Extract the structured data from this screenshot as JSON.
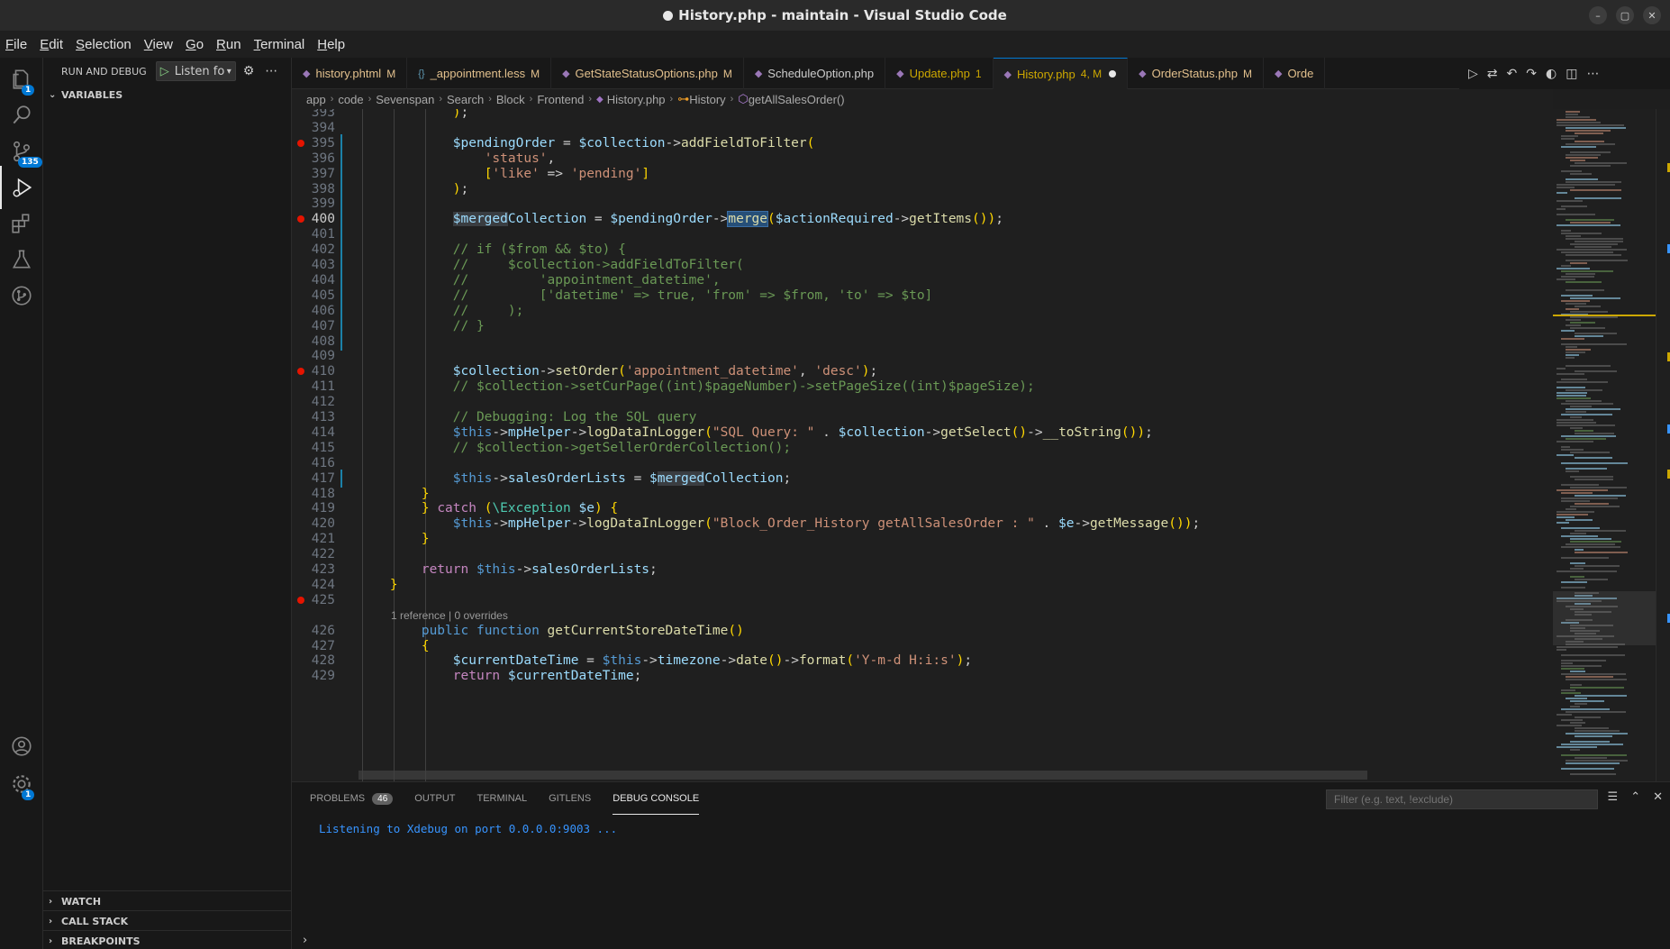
{
  "window": {
    "title": "History.php - maintain - Visual Studio Code",
    "controls": [
      "–",
      "▢",
      "✕"
    ]
  },
  "menu": [
    "File",
    "Edit",
    "Selection",
    "View",
    "Go",
    "Run",
    "Terminal",
    "Help"
  ],
  "activity": {
    "scm_badge": "135",
    "explorer_badge": "1",
    "settings_badge": "1"
  },
  "sidebar": {
    "title": "RUN AND DEBUG",
    "config": "Listen for Xdebug",
    "sections": {
      "variables": "VARIABLES",
      "watch": "WATCH",
      "call_stack": "CALL STACK",
      "breakpoints": "BREAKPOINTS"
    }
  },
  "tabs": [
    {
      "label": "history.phtml",
      "status": "M",
      "icon": "php",
      "color": "#e2c08d"
    },
    {
      "label": "_appointment.less",
      "status": "M",
      "icon": "less",
      "color": "#e2c08d"
    },
    {
      "label": "GetStateStatusOptions.php",
      "status": "M",
      "icon": "php",
      "color": "#e2c08d"
    },
    {
      "label": "ScheduleOption.php",
      "status": "",
      "icon": "php",
      "color": "#cccccc"
    },
    {
      "label": "Update.php",
      "status": "1",
      "icon": "php",
      "color": "#cca700"
    },
    {
      "label": "History.php",
      "status": "4, M",
      "icon": "php",
      "color": "#cca700",
      "active": true,
      "dirty": true
    },
    {
      "label": "OrderStatus.php",
      "status": "M",
      "icon": "php",
      "color": "#e2c08d"
    },
    {
      "label": "Orde",
      "status": "",
      "icon": "php",
      "color": "#e2c08d"
    }
  ],
  "breadcrumbs": [
    "app",
    "code",
    "Sevenspan",
    "Search",
    "Block",
    "Frontend",
    "History.php",
    "History",
    "getAllSalesOrder()"
  ],
  "editor": {
    "codelens": "1 reference | 0 overrides",
    "lines": [
      {
        "n": "393",
        "text": "            );"
      },
      {
        "n": "394",
        "text": ""
      },
      {
        "n": "395",
        "text": "            $pendingOrder = $collection->addFieldToFilter(",
        "bp": true
      },
      {
        "n": "396",
        "text": "                'status',"
      },
      {
        "n": "397",
        "text": "                ['like' => 'pending']"
      },
      {
        "n": "398",
        "text": "            );"
      },
      {
        "n": "399",
        "text": ""
      },
      {
        "n": "400",
        "text": "            $mergedCollection = $pendingOrder->merge($actionRequired->getItems());",
        "bp": true,
        "current": true
      },
      {
        "n": "401",
        "text": ""
      },
      {
        "n": "402",
        "text": "            // if ($from && $to) {"
      },
      {
        "n": "403",
        "text": "            //     $collection->addFieldToFilter("
      },
      {
        "n": "404",
        "text": "            //         'appointment_datetime',"
      },
      {
        "n": "405",
        "text": "            //         ['datetime' => true, 'from' => $from, 'to' => $to]"
      },
      {
        "n": "406",
        "text": "            //     );"
      },
      {
        "n": "407",
        "text": "            // }"
      },
      {
        "n": "408",
        "text": ""
      },
      {
        "n": "409",
        "text": ""
      },
      {
        "n": "410",
        "text": "            $collection->setOrder('appointment_datetime', 'desc');",
        "bp": true
      },
      {
        "n": "411",
        "text": "            // $collection->setCurPage((int)$pageNumber)->setPageSize((int)$pageSize);"
      },
      {
        "n": "412",
        "text": ""
      },
      {
        "n": "413",
        "text": "            // Debugging: Log the SQL query"
      },
      {
        "n": "414",
        "text": "            $this->mpHelper->logDataInLogger(\"SQL Query: \" . $collection->getSelect()->__toString());"
      },
      {
        "n": "415",
        "text": "            // $collection->getSellerOrderCollection();"
      },
      {
        "n": "416",
        "text": ""
      },
      {
        "n": "417",
        "text": "            $this->salesOrderLists = $mergedCollection;"
      },
      {
        "n": "418",
        "text": "        }"
      },
      {
        "n": "419",
        "text": "        } catch (\\Exception $e) {"
      },
      {
        "n": "420",
        "text": "            $this->mpHelper->logDataInLogger(\"Block_Order_History getAllSalesOrder : \" . $e->getMessage());"
      },
      {
        "n": "421",
        "text": "        }"
      },
      {
        "n": "422",
        "text": ""
      },
      {
        "n": "423",
        "text": "        return $this->salesOrderLists;"
      },
      {
        "n": "424",
        "text": "    }"
      },
      {
        "n": "425",
        "text": "",
        "bp": true
      },
      {
        "n": "",
        "text": "",
        "codelens": true
      },
      {
        "n": "426",
        "text": "        public function getCurrentStoreDateTime()"
      },
      {
        "n": "427",
        "text": "        {"
      },
      {
        "n": "428",
        "text": "            $currentDateTime = $this->timezone->date()->format('Y-m-d H:i:s');"
      },
      {
        "n": "429",
        "text": "            return $currentDateTime;"
      }
    ]
  },
  "panel": {
    "tabs": [
      {
        "label": "PROBLEMS",
        "badge": "46"
      },
      {
        "label": "OUTPUT"
      },
      {
        "label": "TERMINAL"
      },
      {
        "label": "GITLENS"
      },
      {
        "label": "DEBUG CONSOLE",
        "active": true
      }
    ],
    "filter_placeholder": "Filter (e.g. text, !exclude)",
    "console": "Listening to Xdebug on port 0.0.0.0:9003 ...",
    "prompt": "›"
  },
  "colors": {
    "accent": "#0078d4",
    "breakpoint": "#e51400",
    "modified": "#e2c08d",
    "warning": "#cca700"
  }
}
